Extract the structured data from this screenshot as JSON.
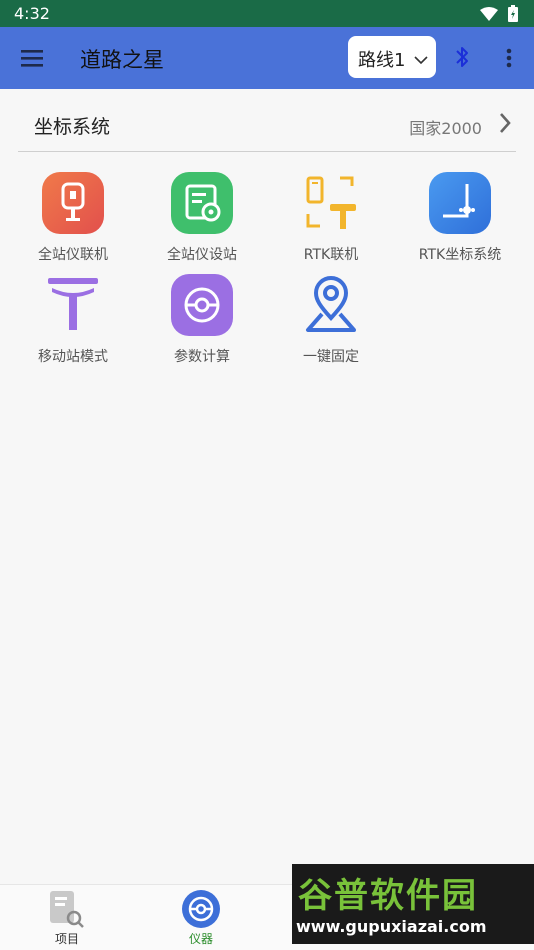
{
  "status_bar": {
    "time": "4:32"
  },
  "app_bar": {
    "title": "道路之星",
    "route_select": {
      "value": "路线1"
    },
    "icons": [
      "menu-icon",
      "bluetooth-icon",
      "more-vert-icon"
    ]
  },
  "coordinate_system": {
    "label": "坐标系统",
    "value": "国家2000"
  },
  "tools": [
    {
      "label": "全站仪联机",
      "icon": "total-station-connect-icon",
      "color": "#e8644a"
    },
    {
      "label": "全站仪设站",
      "icon": "total-station-setup-icon",
      "color": "#3fbf6c"
    },
    {
      "label": "RTK联机",
      "icon": "rtk-connect-icon",
      "color": "#f2b52c"
    },
    {
      "label": "RTK坐标系统",
      "icon": "rtk-coordinate-icon",
      "color": "#3d84e6"
    },
    {
      "label": "移动站模式",
      "icon": "rover-mode-icon",
      "color": "#9b6fe3"
    },
    {
      "label": "参数计算",
      "icon": "parameter-calc-icon",
      "color": "#9b6fe3"
    },
    {
      "label": "一键固定",
      "icon": "one-key-fix-icon",
      "color": "#3d6fd8"
    }
  ],
  "bottom_nav": [
    {
      "label": "项目",
      "icon": "project-icon",
      "active": false
    },
    {
      "label": "仪器",
      "icon": "instrument-icon",
      "active": true
    }
  ],
  "watermark": {
    "text": "谷普软件园",
    "url": "www.gupuxiazai.com"
  },
  "colors": {
    "status_bar": "#1a6b47",
    "app_bar": "#4a72d8",
    "active_tab": "#2a8c2a",
    "accent_blue": "#3d6fd8"
  }
}
